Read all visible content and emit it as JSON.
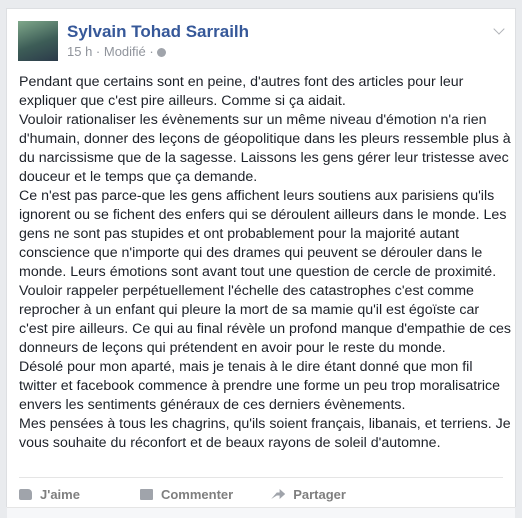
{
  "post": {
    "author": "Sylvain Tohad Sarrailh",
    "time": "15 h",
    "edited": "Modifié",
    "lines": [
      "Pendant que certains sont en peine, d'autres font des articles pour leur",
      "expliquer que c'est pire ailleurs. Comme si ça aidait.",
      "Vouloir rationaliser les évènements sur un même niveau d'émotion n'a rien",
      "d'humain, donner des leçons de géopolitique dans les pleurs ressemble plus à",
      "du narcissisme que de la sagesse. Laissons les gens gérer leur tristesse avec",
      "douceur et le temps que ça demande.",
      "Ce n'est pas parce-que les gens affichent leurs soutiens aux parisiens qu'ils",
      "ignorent ou se fichent des enfers qui se déroulent ailleurs dans le monde. Les",
      "gens ne sont pas stupides et ont probablement pour la majorité autant",
      "conscience que n'importe qui des drames qui peuvent se dérouler dans le",
      "monde. Leurs émotions sont avant tout une question de cercle de proximité.",
      "Vouloir rappeler perpétuellement l'échelle des catastrophes c'est comme",
      "reprocher à un enfant qui pleure la mort de sa mamie qu'il est égoïste car",
      "c'est pire ailleurs. Ce qui au final révèle un profond manque d'empathie de ces",
      "donneurs de leçons qui prétendent en avoir pour le reste du monde.",
      "Désolé pour mon aparté, mais je tenais à le dire étant donné que mon fil",
      "twitter et facebook commence à prendre une forme un peu trop moralisatrice",
      "envers les sentiments généraux de ces derniers évènements.",
      "Mes pensées à tous les chagrins, qu'ils soient français, libanais, et terriens. Je",
      "vous souhaite du réconfort et de beaux rayons de soleil d'automne."
    ]
  },
  "actions": {
    "like": "J'aime",
    "comment": "Commenter",
    "share": "Partager"
  }
}
